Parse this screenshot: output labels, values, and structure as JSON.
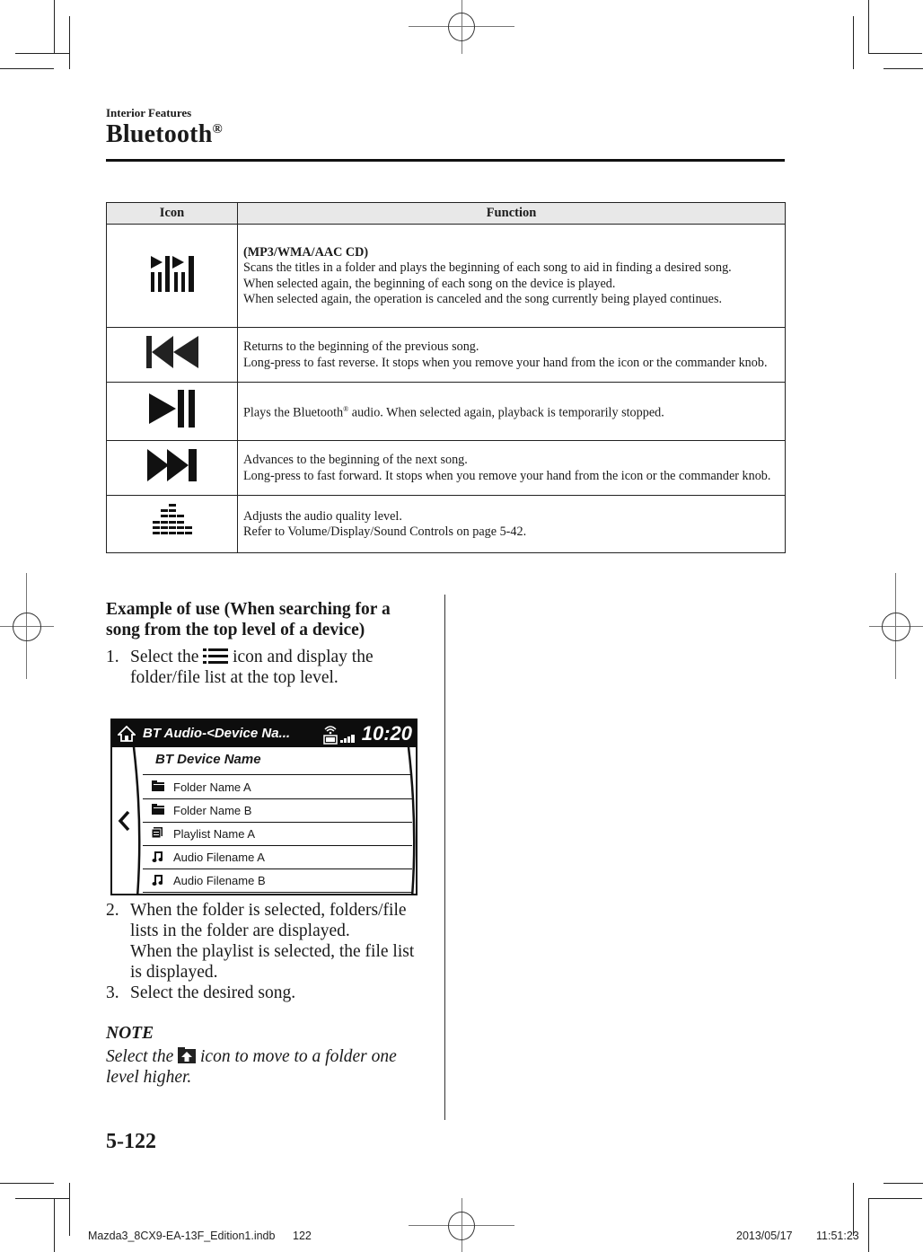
{
  "header": {
    "section": "Interior Features",
    "title": "Bluetooth",
    "title_mark": "®"
  },
  "table": {
    "columns": [
      "Icon",
      "Function"
    ],
    "rows": [
      {
        "icon": "scan-icon",
        "lines": [
          {
            "text": "(MP3/WMA/AAC CD)",
            "bold": true
          },
          {
            "text": "Scans the titles in a folder and plays the beginning of each song to aid in finding a desired song."
          },
          {
            "text": "When selected again, the beginning of each song on the device is played."
          },
          {
            "text": "When selected again, the operation is canceled and the song currently being played continues."
          }
        ]
      },
      {
        "icon": "previous-track-icon",
        "lines": [
          {
            "text": "Returns to the beginning of the previous song."
          },
          {
            "text": "Long-press to fast reverse. It stops when you remove your hand from the icon or the commander knob."
          }
        ]
      },
      {
        "icon": "play-pause-icon",
        "lines": [
          {
            "text_before": "Plays the Bluetooth",
            "mark": "®",
            "text_after": " audio. When selected again, playback is temporarily stopped."
          }
        ]
      },
      {
        "icon": "next-track-icon",
        "lines": [
          {
            "text": "Advances to the beginning of the next song."
          },
          {
            "text": "Long-press to fast forward. It stops when you remove your hand from the icon or the commander knob."
          }
        ]
      },
      {
        "icon": "sound-settings-icon",
        "lines": [
          {
            "text": "Adjusts the audio quality level."
          },
          {
            "text": "Refer to Volume/Display/Sound Controls on page 5-42."
          }
        ]
      }
    ]
  },
  "example": {
    "heading": "Example of use (When searching for a song from the top level of a device)",
    "step1": {
      "num": "1.",
      "before": "Select the",
      "icon": "list-icon",
      "after": "icon and display the folder/file list at the top level."
    },
    "step2": {
      "num": "2.",
      "lines": [
        "When the folder is selected, folders/file lists in the folder are displayed.",
        "When the playlist is selected, the file list is displayed."
      ]
    },
    "step3": {
      "num": "3.",
      "text": "Select the desired song."
    }
  },
  "screen": {
    "title": "BT Audio-<Device Na...",
    "clock": "10:20",
    "list_header": "BT Device Name",
    "items": [
      {
        "icon": "folder-icon",
        "label": "Folder Name A"
      },
      {
        "icon": "folder-icon",
        "label": "Folder Name B"
      },
      {
        "icon": "playlist-icon",
        "label": "Playlist Name A"
      },
      {
        "icon": "music-note-icon",
        "label": "Audio Filename A"
      },
      {
        "icon": "music-note-icon",
        "label": "Audio Filename B"
      }
    ]
  },
  "note": {
    "heading": "NOTE",
    "before": "Select the",
    "icon": "folder-up-icon",
    "after": "icon to move to a folder one level higher."
  },
  "page_number": "5-122",
  "footer": {
    "file": "Mazda3_8CX9-EA-13F_Edition1.indb",
    "page": "122",
    "date": "2013/05/17",
    "time": "11:51:23"
  }
}
